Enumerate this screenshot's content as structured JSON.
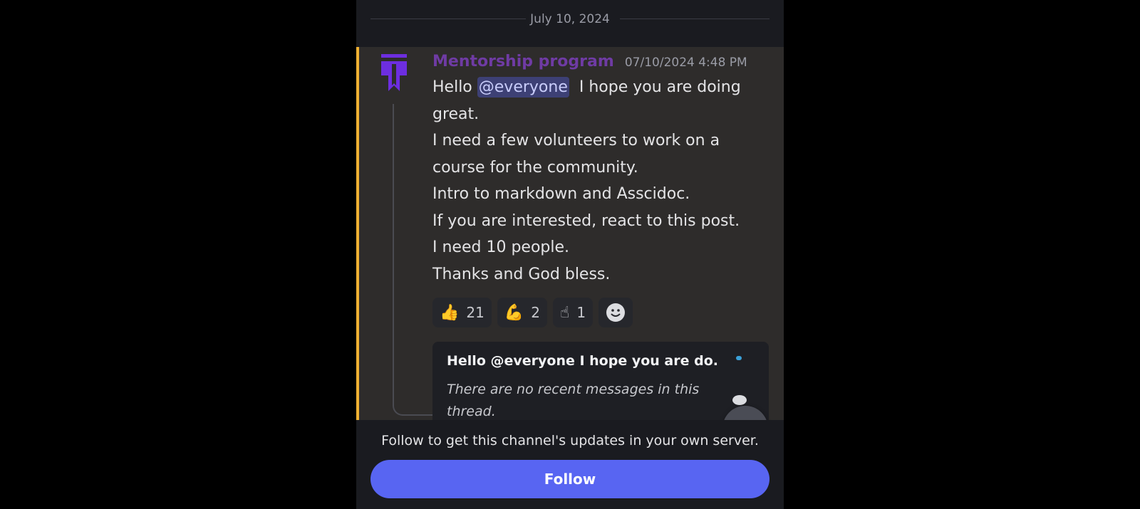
{
  "date_divider": "July 10, 2024",
  "message": {
    "author": "Mentorship program",
    "timestamp": "07/10/2024 4:48 PM",
    "greeting": "Hello",
    "mention": "@everyone",
    "line1_rest": "I hope you are doing",
    "line2": "great.",
    "line3": "I need a few volunteers to work on a",
    "line4": "course for the community.",
    "line5": "Intro to markdown and Asscidoc.",
    "line6": "If you are interested, react to this post.",
    "line7": "I need 10 people.",
    "line8": "Thanks and God bless."
  },
  "reactions": [
    {
      "emoji": "👍",
      "icon": "thumbs-up-icon",
      "count": "21"
    },
    {
      "emoji": "💪",
      "icon": "flexed-biceps-icon",
      "count": "2"
    },
    {
      "emoji": "☝",
      "icon": "index-pointing-up-icon",
      "count": "1"
    }
  ],
  "thread": {
    "title": "Hello @everyone  I hope you are do...",
    "empty_text": "There are no recent messages in this thread."
  },
  "footer": {
    "text": "Follow to get this channel's updates in your own server.",
    "follow_label": "Follow"
  },
  "colors": {
    "accent_bar": "#f0b132",
    "author": "#6f3ba4",
    "follow_button": "#5865f2",
    "mention_bg": "#3d4075"
  }
}
